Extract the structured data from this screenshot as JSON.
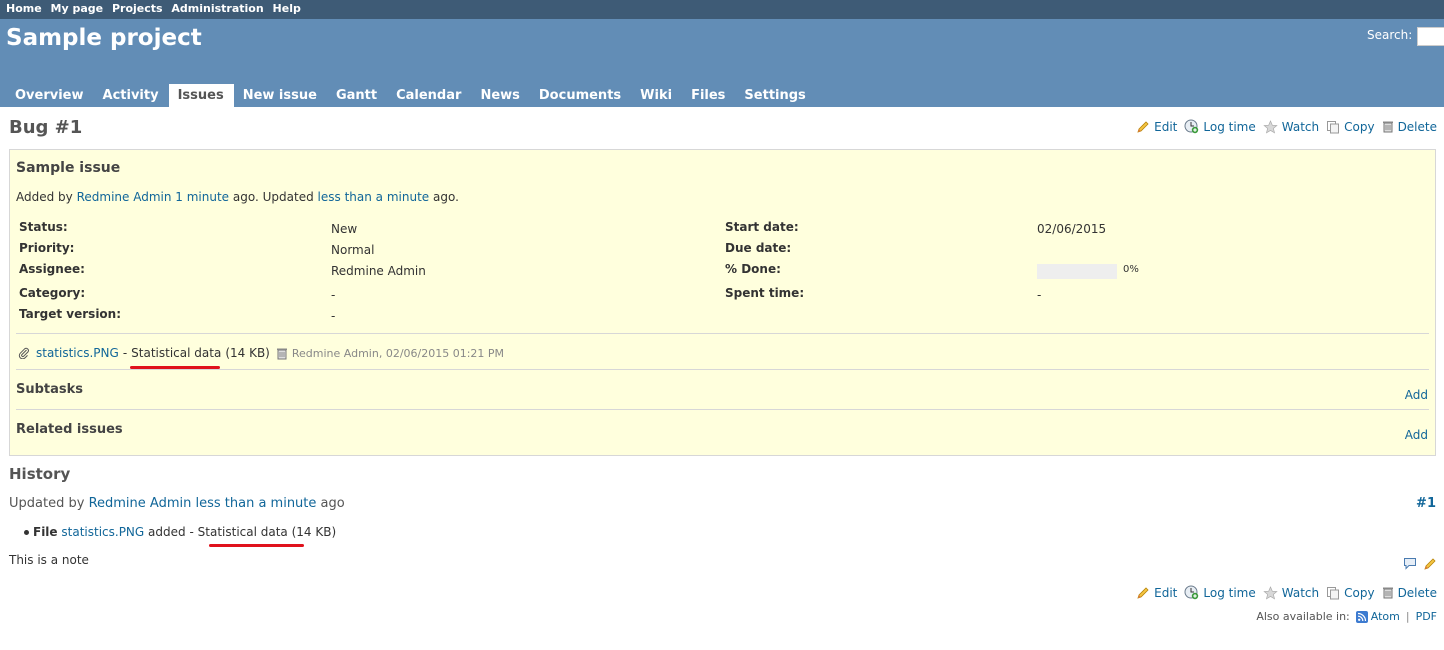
{
  "top_menu": [
    "Home",
    "My page",
    "Projects",
    "Administration",
    "Help"
  ],
  "header": {
    "project_title": "Sample project",
    "search_label": "Search:",
    "search_value": ""
  },
  "tabs": [
    {
      "label": "Overview"
    },
    {
      "label": "Activity"
    },
    {
      "label": "Issues",
      "selected": true
    },
    {
      "label": "New issue"
    },
    {
      "label": "Gantt"
    },
    {
      "label": "Calendar"
    },
    {
      "label": "News"
    },
    {
      "label": "Documents"
    },
    {
      "label": "Wiki"
    },
    {
      "label": "Files"
    },
    {
      "label": "Settings"
    }
  ],
  "issue": {
    "heading": "Bug #1",
    "subject": "Sample issue",
    "author_line": {
      "added_by": "Added by",
      "author": "Redmine Admin",
      "created": "1 minute",
      "updated_text": "ago. Updated",
      "updated": "less than a minute",
      "ago": "ago."
    },
    "attributes": {
      "status": {
        "label": "Status:",
        "value": "New"
      },
      "priority": {
        "label": "Priority:",
        "value": "Normal"
      },
      "assignee": {
        "label": "Assignee:",
        "value": "Redmine Admin"
      },
      "category": {
        "label": "Category:",
        "value": "-"
      },
      "target_version": {
        "label": "Target version:",
        "value": "-"
      },
      "start_date": {
        "label": "Start date:",
        "value": "02/06/2015"
      },
      "due_date": {
        "label": "Due date:",
        "value": ""
      },
      "done": {
        "label": "% Done:",
        "value": "0%",
        "fraction": 0
      },
      "spent_time": {
        "label": "Spent time:",
        "value": "-"
      }
    },
    "attachment": {
      "filename": "statistics.PNG",
      "dash": "-",
      "description": "Statistical data",
      "size": "(14 KB)",
      "meta": "Redmine Admin, 02/06/2015 01:21 PM"
    },
    "subtasks": {
      "title": "Subtasks",
      "add": "Add"
    },
    "related": {
      "title": "Related issues",
      "add": "Add"
    }
  },
  "actions": {
    "edit": "Edit",
    "log_time": "Log time",
    "watch": "Watch",
    "copy": "Copy",
    "delete": "Delete"
  },
  "history": {
    "title": "History",
    "journal": {
      "updated_by": "Updated by",
      "author": "Redmine Admin",
      "when": "less than a minute",
      "ago": "ago",
      "anchor": "#1",
      "detail": {
        "prefix": "File",
        "filename": "statistics.PNG",
        "added": "added",
        "dash": "-",
        "description": "Statistical data",
        "size": "(14 KB)"
      },
      "note": "This is a note"
    }
  },
  "other_formats": {
    "label": "Also available in:",
    "atom": "Atom",
    "sep": "|",
    "pdf": "PDF"
  },
  "colors": {
    "top_menu_bg": "#3E5B76",
    "header_bg": "#628DB6",
    "issue_bg": "#ffffdd",
    "link": "#116699",
    "highlight_underline": "#e0111c"
  }
}
